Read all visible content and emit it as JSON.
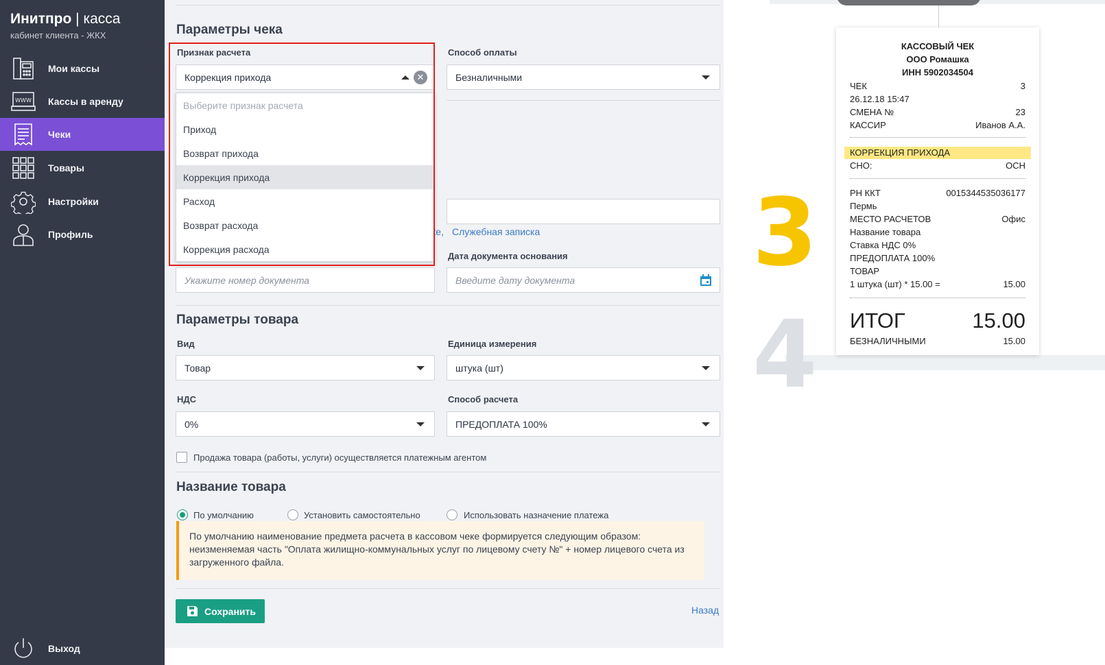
{
  "sidebar": {
    "brand_bold": "Инитпро",
    "brand_sep": " | ",
    "brand_thin": "касса",
    "subtitle": "кабинет клиента - ЖКХ",
    "items": [
      {
        "label": "Мои кассы",
        "icon": "cash-register-icon"
      },
      {
        "label": "Кассы в аренду",
        "icon": "www-register-icon"
      },
      {
        "label": "Чеки",
        "icon": "receipt-icon",
        "active": true
      },
      {
        "label": "Товары",
        "icon": "grid-icon"
      },
      {
        "label": "Настройки",
        "icon": "gear-icon"
      },
      {
        "label": "Профиль",
        "icon": "user-icon"
      }
    ],
    "logout": {
      "label": "Выход",
      "icon": "power-icon"
    }
  },
  "receipt_params": {
    "title": "Параметры чека",
    "calc_sign": {
      "label": "Признак расчета",
      "value": "Коррекция прихода",
      "options_hint": "Выберите признак расчета",
      "options": [
        "Приход",
        "Возврат прихода",
        "Коррекция прихода",
        "Расход",
        "Возврат расхода",
        "Коррекция расхода"
      ],
      "selected": "Коррекция прихода"
    },
    "payment_method": {
      "label": "Способ оплаты",
      "value": "Безналичными"
    },
    "doc_link_partial": "ке,",
    "doc_link": "Служебная записка",
    "doc_number_placeholder": "Укажите номер документа",
    "doc_date": {
      "label": "Дата документа основания",
      "placeholder": "Введите дату документа"
    }
  },
  "product_params": {
    "title": "Параметры товара",
    "kind": {
      "label": "Вид",
      "value": "Товар"
    },
    "unit": {
      "label": "Единица измерения",
      "value": "штука (шт)"
    },
    "vat": {
      "label": "НДС",
      "value": "0%"
    },
    "calc_method": {
      "label": "Способ расчета",
      "value": "ПРЕДОПЛАТА 100%"
    },
    "agent_checkbox": "Продажа товара (работы, услуги) осуществляется платежным агентом"
  },
  "product_name": {
    "title": "Название товара",
    "radios": [
      "По умолчанию",
      "Установить самостоятельно",
      "Использовать назначение платежа"
    ],
    "selected": "По умолчанию",
    "info": "По умолчанию наименование предмета расчета в кассовом чеке формируется следующим образом: неизменяемая часть \"Оплата жилищно-коммунальных услуг по лицевому счету №\" + номер лицевого счета из загруженного файла."
  },
  "actions": {
    "save": "Сохранить",
    "back": "Назад"
  },
  "receipt": {
    "title": "КАССОВЫЙ ЧЕК",
    "org": "ООО Ромашка",
    "inn": "ИНН 5902034504",
    "rows_top": [
      [
        "ЧЕК",
        "3"
      ],
      [
        "26.12.18 15:47",
        ""
      ],
      [
        "СМЕНА №",
        "23"
      ],
      [
        "КАССИР",
        "Иванов А.А."
      ]
    ],
    "highlight": "КОРРЕКЦИЯ ПРИХОДА",
    "sno": [
      "СНО:",
      "ОСН"
    ],
    "rows_mid": [
      [
        "РН ККТ",
        "0015344535036177"
      ],
      [
        "Пермь",
        ""
      ],
      [
        "МЕСТО РАСЧЕТОВ",
        "Офис"
      ],
      [
        "Название товара",
        ""
      ],
      [
        "Ставка НДС 0%",
        ""
      ],
      [
        "ПРЕДОПЛАТА 100%",
        ""
      ],
      [
        "ТОВАР",
        ""
      ],
      [
        "1 штука (шт) * 15.00 =",
        "15.00"
      ]
    ],
    "total_label": "ИТОГ",
    "total_value": "15.00",
    "payment": [
      "БЕЗНАЛИЧНЫМИ",
      "15.00"
    ],
    "step_numbers": [
      "3",
      "4"
    ]
  },
  "colors": {
    "sidebar_bg": "#343a48",
    "active_nav": "#7b4fd6",
    "primary_btn": "#1a9f84",
    "highlight_border": "#e0201a",
    "step3": "#f7c400",
    "step4": "#dcdfe3",
    "receipt_highlight": "#ffe884"
  }
}
